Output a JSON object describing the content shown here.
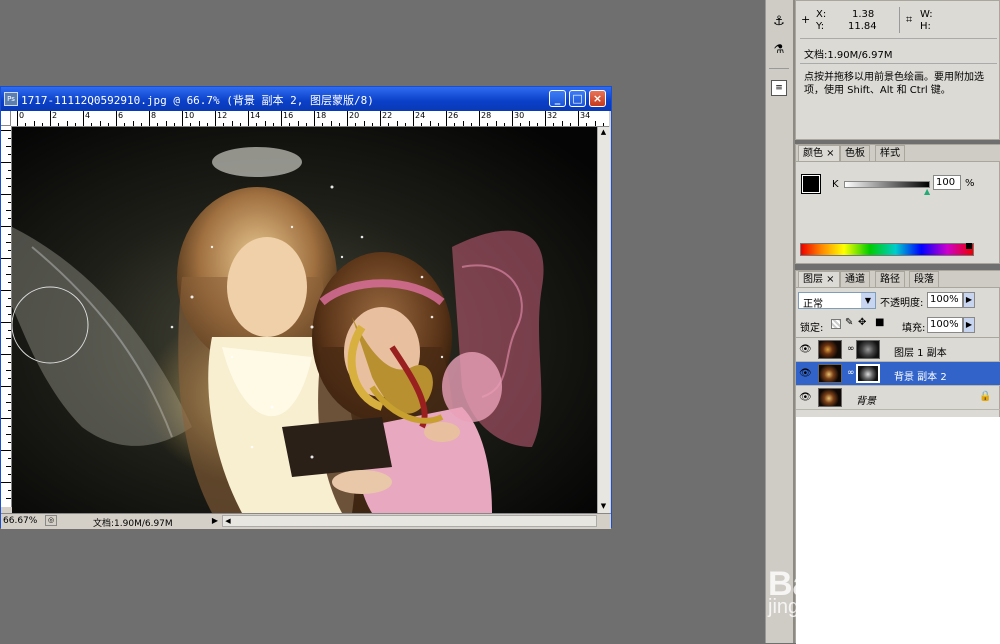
{
  "info_panel": {
    "x_label": "X:",
    "x_value": "1.38",
    "y_label": "Y:",
    "y_value": "11.84",
    "w_label": "W:",
    "h_label": "H:",
    "doc_info": "文档:1.90M/6.97M",
    "hint": "点按并拖移以用前景色绘画。要用附加选项，使用 Shift、Alt 和 Ctrl 键。"
  },
  "color_panel": {
    "tabs": [
      "颜色",
      "色板",
      "样式"
    ],
    "channel_label": "K",
    "channel_value": "100",
    "unit": "%"
  },
  "layers_panel": {
    "tabs": [
      "图层",
      "通道",
      "路径",
      "段落"
    ],
    "blend_mode": "正常",
    "opacity_label": "不透明度:",
    "opacity_value": "100%",
    "lock_label": "锁定:",
    "fill_label": "填充:",
    "fill_value": "100%",
    "layers": [
      {
        "name": "图层 1 副本",
        "selected": false
      },
      {
        "name": "背景 副本 2",
        "selected": true
      },
      {
        "name": "背景",
        "selected": false
      }
    ]
  },
  "document": {
    "title": "1717-11112Q0592910.jpg @ 66.7% (背景 副本 2, 图层蒙版/8)",
    "zoom": "66.67%",
    "doc_info": "文档:1.90M/6.97M",
    "ruler_labels": [
      "0",
      "2",
      "4",
      "6",
      "8",
      "10",
      "12",
      "14",
      "16",
      "18",
      "20",
      "22",
      "24",
      "26",
      "28",
      "30",
      "32",
      "34"
    ]
  },
  "watermark": {
    "brand": "Bai  经验",
    "url": "jingyan.baidu.com"
  },
  "colors": {
    "canvas_bg": "#6f6f6f",
    "title_blue": "#0a3fc8",
    "selection": "#3163c9"
  }
}
